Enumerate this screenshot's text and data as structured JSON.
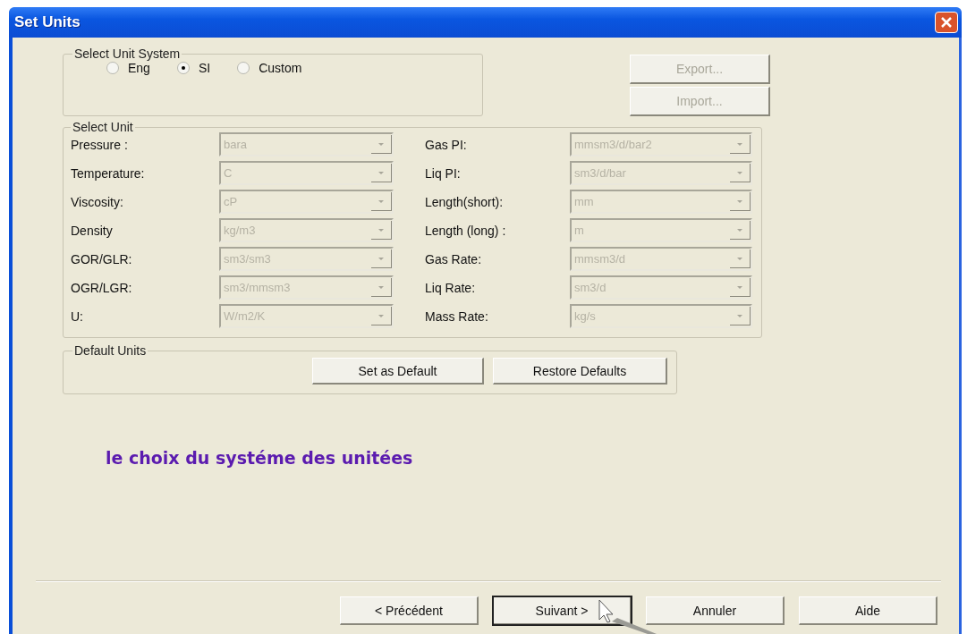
{
  "window": {
    "title": "Set Units"
  },
  "unit_system": {
    "legend": "Select Unit System",
    "options": [
      {
        "label": "Eng",
        "selected": false
      },
      {
        "label": "SI",
        "selected": true
      },
      {
        "label": "Custom",
        "selected": false
      }
    ]
  },
  "side_buttons": [
    {
      "label": "Export...",
      "disabled": true
    },
    {
      "label": "Import...",
      "disabled": true
    }
  ],
  "select_unit": {
    "legend": "Select Unit",
    "rows": [
      {
        "left": {
          "label": "Pressure :",
          "value": "bara",
          "disabled": true
        },
        "right": {
          "label": "Gas PI:",
          "value": "mmsm3/d/bar2",
          "disabled": true
        }
      },
      {
        "left": {
          "label": "Temperature:",
          "value": "C",
          "disabled": true
        },
        "right": {
          "label": "Liq PI:",
          "value": "sm3/d/bar",
          "disabled": true
        }
      },
      {
        "left": {
          "label": "Viscosity:",
          "value": "cP",
          "disabled": true
        },
        "right": {
          "label": "Length(short):",
          "value": "mm",
          "disabled": true
        }
      },
      {
        "left": {
          "label": "Density",
          "value": "kg/m3",
          "disabled": true
        },
        "right": {
          "label": "Length (long) :",
          "value": "m",
          "disabled": true
        }
      },
      {
        "left": {
          "label": "GOR/GLR:",
          "value": "sm3/sm3",
          "disabled": true
        },
        "right": {
          "label": "Gas Rate:",
          "value": "mmsm3/d",
          "disabled": true
        }
      },
      {
        "left": {
          "label": "OGR/LGR:",
          "value": "sm3/mmsm3",
          "disabled": true
        },
        "right": {
          "label": "Liq Rate:",
          "value": "sm3/d",
          "disabled": true
        }
      },
      {
        "left": {
          "label": "U:",
          "value": "W/m2/K",
          "disabled": true
        },
        "right": {
          "label": "Mass Rate:",
          "value": "kg/s",
          "disabled": true
        }
      }
    ]
  },
  "default_units": {
    "legend": "Default Units",
    "buttons": [
      "Set as Default",
      "Restore Defaults"
    ]
  },
  "caption": "le choix du systéme des unitées",
  "footer_buttons": [
    {
      "label": "< Précédent",
      "focused": false
    },
    {
      "label": "Suivant >",
      "focused": true
    },
    {
      "label": "Annuler",
      "focused": false
    },
    {
      "label": "Aide",
      "focused": false
    }
  ]
}
